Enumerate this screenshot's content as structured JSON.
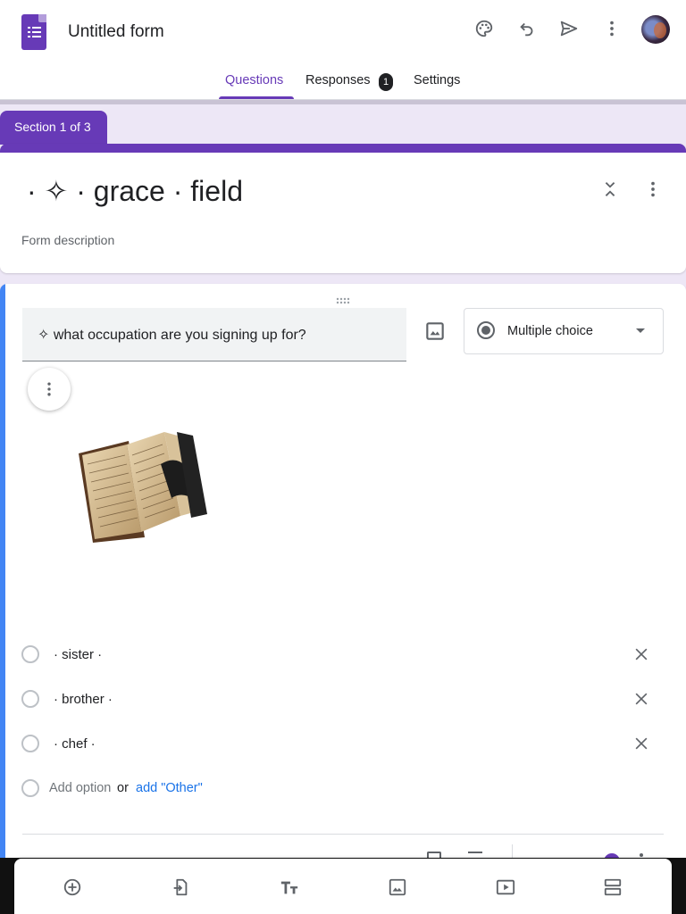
{
  "app": {
    "title": "Untitled form"
  },
  "header": {
    "icons": [
      "palette-icon",
      "undo-icon",
      "send-icon",
      "more-vert-icon",
      "avatar"
    ]
  },
  "tabs": [
    {
      "label": "Questions",
      "active": true
    },
    {
      "label": "Responses",
      "badge": "1"
    },
    {
      "label": "Settings"
    }
  ],
  "section": {
    "tab_label": "Section 1 of 3",
    "title": "· ✧ · grace · field",
    "description_placeholder": "Form description"
  },
  "question": {
    "title": "✧ what occupation are you signing up for?",
    "type": "Multiple choice",
    "options": [
      {
        "label": "· sister ·"
      },
      {
        "label": "· brother ·"
      },
      {
        "label": "· chef ·"
      }
    ],
    "add_option": "Add option",
    "or": "or",
    "add_other": "add \"Other\""
  },
  "toolbar": {
    "items": [
      "add-question-icon",
      "import-questions-icon",
      "add-title-icon",
      "add-image-icon",
      "add-video-icon",
      "add-section-icon"
    ]
  },
  "colors": {
    "accent": "#673ab7",
    "focus": "#4285f4",
    "link": "#1a73e8",
    "background": "#ede7f6"
  }
}
